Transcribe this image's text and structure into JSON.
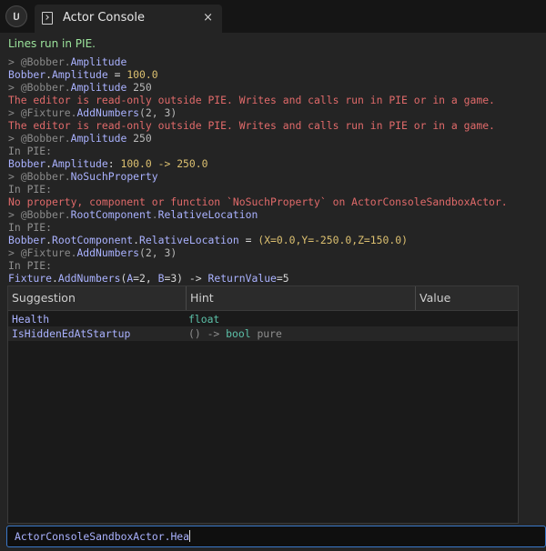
{
  "window": {
    "logo_icon": "unreal-engine-logo-icon",
    "tab": {
      "label": "Actor Console",
      "icon": "console-icon",
      "close": "×"
    }
  },
  "status_message": "Lines run in PIE.",
  "log": [
    [
      {
        "t": "> ",
        "c": "prompt"
      },
      {
        "t": "@Bobber",
        "c": "ref"
      },
      {
        "t": ".",
        "c": "prompt"
      },
      {
        "t": "Amplitude",
        "c": "name"
      }
    ],
    [
      {
        "t": "Bobber",
        "c": "name"
      },
      {
        "t": ".",
        "c": "white"
      },
      {
        "t": "Amplitude",
        "c": "name"
      },
      {
        "t": " = ",
        "c": "white"
      },
      {
        "t": "100.0",
        "c": "val"
      }
    ],
    [
      {
        "t": "> ",
        "c": "prompt"
      },
      {
        "t": "@Bobber",
        "c": "ref"
      },
      {
        "t": ".",
        "c": "prompt"
      },
      {
        "t": "Amplitude",
        "c": "name"
      },
      {
        "t": " 250",
        "c": "num"
      }
    ],
    [
      {
        "t": "The editor is read-only outside PIE. Writes and calls run in PIE or in a game.",
        "c": "err"
      }
    ],
    [
      {
        "t": "> ",
        "c": "prompt"
      },
      {
        "t": "@Fixture",
        "c": "ref"
      },
      {
        "t": ".",
        "c": "prompt"
      },
      {
        "t": "AddNumbers",
        "c": "name"
      },
      {
        "t": "(2, 3)",
        "c": "num"
      }
    ],
    [
      {
        "t": "The editor is read-only outside PIE. Writes and calls run in PIE or in a game.",
        "c": "err"
      }
    ],
    [
      {
        "t": "> ",
        "c": "prompt"
      },
      {
        "t": "@Bobber",
        "c": "ref"
      },
      {
        "t": ".",
        "c": "prompt"
      },
      {
        "t": "Amplitude",
        "c": "name"
      },
      {
        "t": " 250",
        "c": "num"
      }
    ],
    [
      {
        "t": "In PIE:",
        "c": "dim"
      }
    ],
    [
      {
        "t": "Bobber",
        "c": "name"
      },
      {
        "t": ".",
        "c": "white"
      },
      {
        "t": "Amplitude",
        "c": "name"
      },
      {
        "t": ": ",
        "c": "white"
      },
      {
        "t": "100.0 -> 250.0",
        "c": "val"
      }
    ],
    [
      {
        "t": "> ",
        "c": "prompt"
      },
      {
        "t": "@Bobber",
        "c": "ref"
      },
      {
        "t": ".",
        "c": "prompt"
      },
      {
        "t": "NoSuchProperty",
        "c": "name"
      }
    ],
    [
      {
        "t": "In PIE:",
        "c": "dim"
      }
    ],
    [
      {
        "t": "No property, component or function `NoSuchProperty` on ActorConsoleSandboxActor.",
        "c": "err"
      }
    ],
    [
      {
        "t": "> ",
        "c": "prompt"
      },
      {
        "t": "@Bobber",
        "c": "ref"
      },
      {
        "t": ".",
        "c": "prompt"
      },
      {
        "t": "RootComponent",
        "c": "name"
      },
      {
        "t": ".",
        "c": "prompt"
      },
      {
        "t": "RelativeLocation",
        "c": "name"
      }
    ],
    [
      {
        "t": "In PIE:",
        "c": "dim"
      }
    ],
    [
      {
        "t": "Bobber",
        "c": "name"
      },
      {
        "t": ".",
        "c": "white"
      },
      {
        "t": "RootComponent",
        "c": "name"
      },
      {
        "t": ".",
        "c": "white"
      },
      {
        "t": "RelativeLocation",
        "c": "name"
      },
      {
        "t": " = ",
        "c": "white"
      },
      {
        "t": "(X=0.0,Y=-250.0,Z=150.0)",
        "c": "val"
      }
    ],
    [
      {
        "t": "> ",
        "c": "prompt"
      },
      {
        "t": "@Fixture",
        "c": "ref"
      },
      {
        "t": ".",
        "c": "prompt"
      },
      {
        "t": "AddNumbers",
        "c": "name"
      },
      {
        "t": "(2, 3)",
        "c": "num"
      }
    ],
    [
      {
        "t": "In PIE:",
        "c": "dim"
      }
    ],
    [
      {
        "t": "Fixture",
        "c": "name"
      },
      {
        "t": ".",
        "c": "white"
      },
      {
        "t": "AddNumbers",
        "c": "name"
      },
      {
        "t": "(",
        "c": "white"
      },
      {
        "t": "A",
        "c": "key"
      },
      {
        "t": "=2, ",
        "c": "white"
      },
      {
        "t": "B",
        "c": "key"
      },
      {
        "t": "=3) -> ",
        "c": "white"
      },
      {
        "t": "ReturnValue",
        "c": "key"
      },
      {
        "t": "=5",
        "c": "white"
      }
    ]
  ],
  "suggestions": {
    "columns": {
      "suggestion": "Suggestion",
      "hint": "Hint",
      "value": "Value"
    },
    "rows": [
      {
        "name": "Health",
        "hint": [
          {
            "t": "float",
            "c": "teal"
          }
        ]
      },
      {
        "name": "IsHiddenEdAtStartup",
        "hint": [
          {
            "t": "() -> ",
            "c": "dim"
          },
          {
            "t": "bool",
            "c": "teal"
          },
          {
            "t": "  pure",
            "c": "dim"
          }
        ]
      }
    ]
  },
  "input": {
    "value": "ActorConsoleSandboxActor.Hea"
  }
}
